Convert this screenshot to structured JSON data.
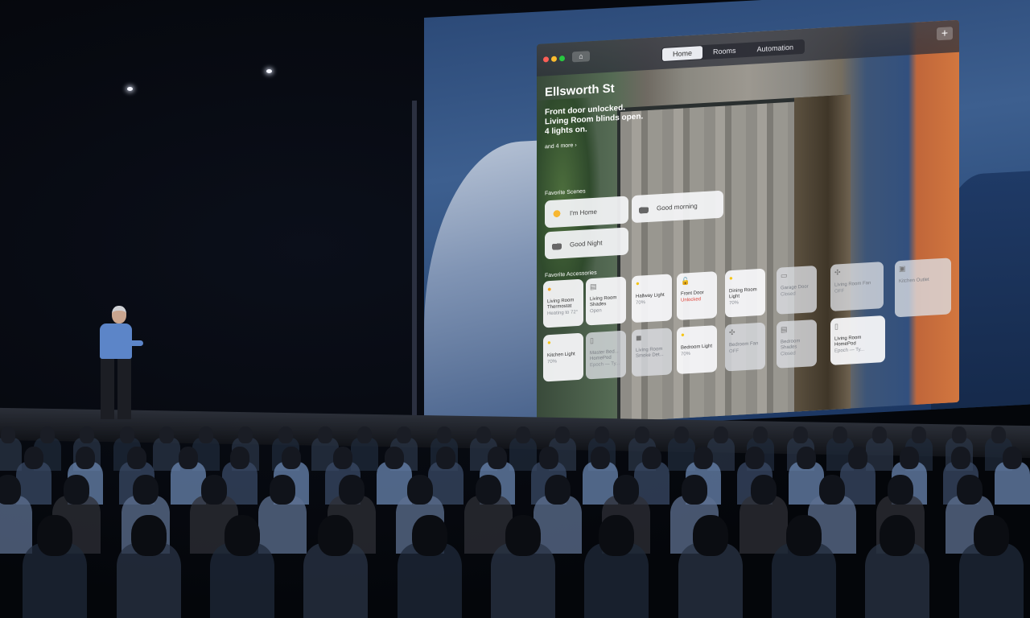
{
  "app": {
    "tabs": [
      "Home",
      "Rooms",
      "Automation"
    ],
    "active_tab": "Home",
    "home_glyph": "⌂",
    "add_glyph": "+",
    "home_name": "Ellsworth St",
    "status_lines": [
      "Front door unlocked.",
      "Living Room blinds open.",
      "4 lights on."
    ],
    "more_link": "and 4 more ›",
    "favorite_scenes_label": "Favorite Scenes",
    "scenes": [
      {
        "name": "I'm Home",
        "icon": "sun-house-icon"
      },
      {
        "name": "Good morning",
        "icon": "house-icon"
      },
      {
        "name": "Good Night",
        "icon": "house-icon"
      }
    ],
    "favorite_accessories_label": "Favorite Accessories",
    "accessories": [
      {
        "name": "Living Room Thermostat",
        "state": "Heating to 72°",
        "on": true,
        "icon": "thermostat-icon",
        "glyph": "●"
      },
      {
        "name": "Living Room Shades",
        "state": "Open",
        "on": true,
        "icon": "shades-icon",
        "glyph": "▤"
      },
      {
        "name": "Hallway Light",
        "state": "70%",
        "on": true,
        "icon": "lightbulb-icon",
        "glyph": "💡"
      },
      {
        "name": "Front Door",
        "state": "Unlocked",
        "on": true,
        "icon": "unlocked-icon",
        "glyph": "🔓"
      },
      {
        "name": "Dining Room Light",
        "state": "70%",
        "on": true,
        "icon": "lightbulb-icon",
        "glyph": "💡"
      },
      {
        "name": "Garage Door",
        "state": "Closed",
        "on": false,
        "icon": "garage-icon",
        "glyph": "▭"
      },
      {
        "name": "Living Room Fan",
        "state": "OFF",
        "on": false,
        "icon": "fan-icon",
        "glyph": "✣"
      },
      {
        "name": "Kitchen Outlet",
        "state": "",
        "on": false,
        "icon": "outlet-icon",
        "glyph": "▣"
      },
      {
        "name": "Kitchen Light",
        "state": "70%",
        "on": true,
        "icon": "lightbulb-icon",
        "glyph": "💡"
      },
      {
        "name": "Master Bed... HomePod",
        "state": "Epoch — Ty...",
        "on": false,
        "icon": "homepod-icon",
        "glyph": "▯"
      },
      {
        "name": "Living Room Smoke Det...",
        "state": "",
        "on": false,
        "icon": "smoke-detector-icon",
        "glyph": "◼"
      },
      {
        "name": "Bedroom Light",
        "state": "70%",
        "on": true,
        "icon": "lightbulb-icon",
        "glyph": "💡"
      },
      {
        "name": "Bedroom Fan",
        "state": "OFF",
        "on": false,
        "icon": "fan-icon",
        "glyph": "✣"
      },
      {
        "name": "Bedroom Shades",
        "state": "Closed",
        "on": false,
        "icon": "shades-icon",
        "glyph": "▤"
      },
      {
        "name": "Living Room HomePod",
        "state": "Epoch — Ty...",
        "on": true,
        "icon": "homepod-icon",
        "glyph": "▯"
      }
    ]
  }
}
